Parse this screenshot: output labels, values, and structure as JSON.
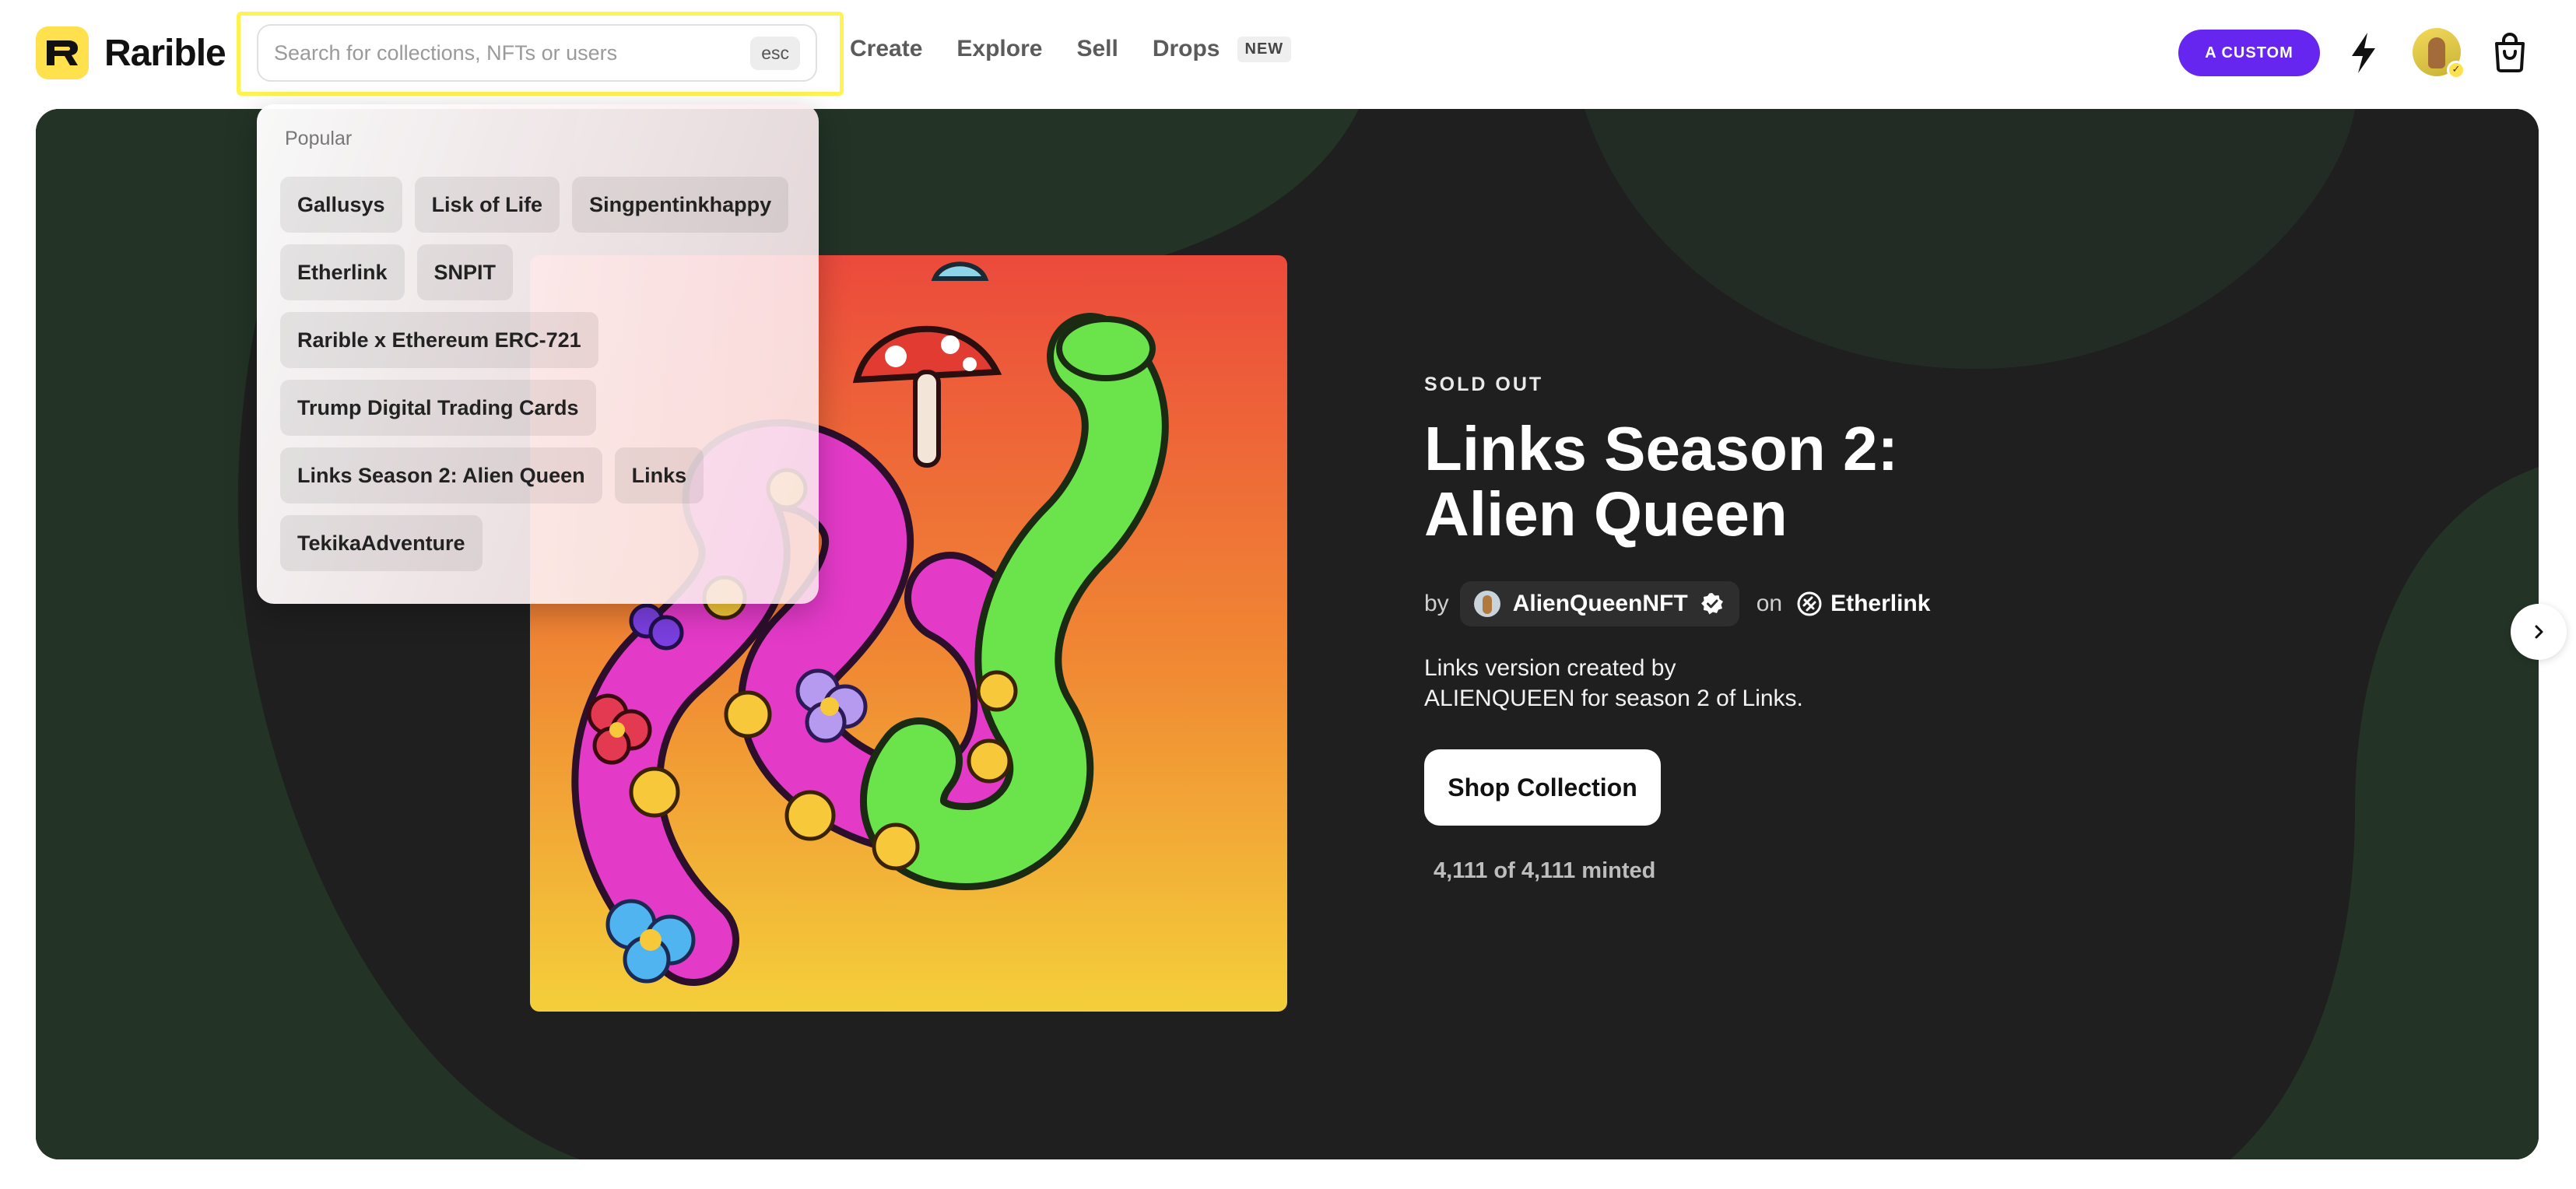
{
  "header": {
    "logo_text": "Rarible",
    "search": {
      "placeholder": "Search for collections, NFTs or users",
      "shortcut": "esc"
    },
    "nav": [
      {
        "label": "Create"
      },
      {
        "label": "Explore"
      },
      {
        "label": "Sell"
      },
      {
        "label": "Drops",
        "badge": "NEW"
      }
    ],
    "custom_button": "A CUSTOM",
    "icons": [
      "bolt-icon",
      "avatar",
      "shopping-bag-icon"
    ]
  },
  "search_dropdown": {
    "title": "Popular",
    "rows": [
      [
        "Gallusys",
        "Lisk of Life",
        "Singpentinkhappy"
      ],
      [
        "Etherlink",
        "SNPIT"
      ],
      [
        "Rarible x Ethereum ERC-721"
      ],
      [
        "Trump Digital Trading Cards"
      ],
      [
        "Links Season 2: Alien Queen",
        "Links"
      ],
      [
        "TekikaAdventure"
      ]
    ]
  },
  "hero": {
    "status": "SOLD OUT",
    "title": "Links Season 2: Alien Queen",
    "by_label": "by",
    "creator": "AlienQueenNFT",
    "on_label": "on",
    "chain": "Etherlink",
    "description": "Links version created by ALIENQUEEN for season 2 of Links.",
    "cta": "Shop Collection",
    "minted": "4,111 of 4,111 minted"
  },
  "colors": {
    "brand_yellow": "#FFE14D",
    "accent_purple": "#6626F0",
    "hero_bg": "#1f1f1f",
    "highlight": "#FFF44F"
  }
}
